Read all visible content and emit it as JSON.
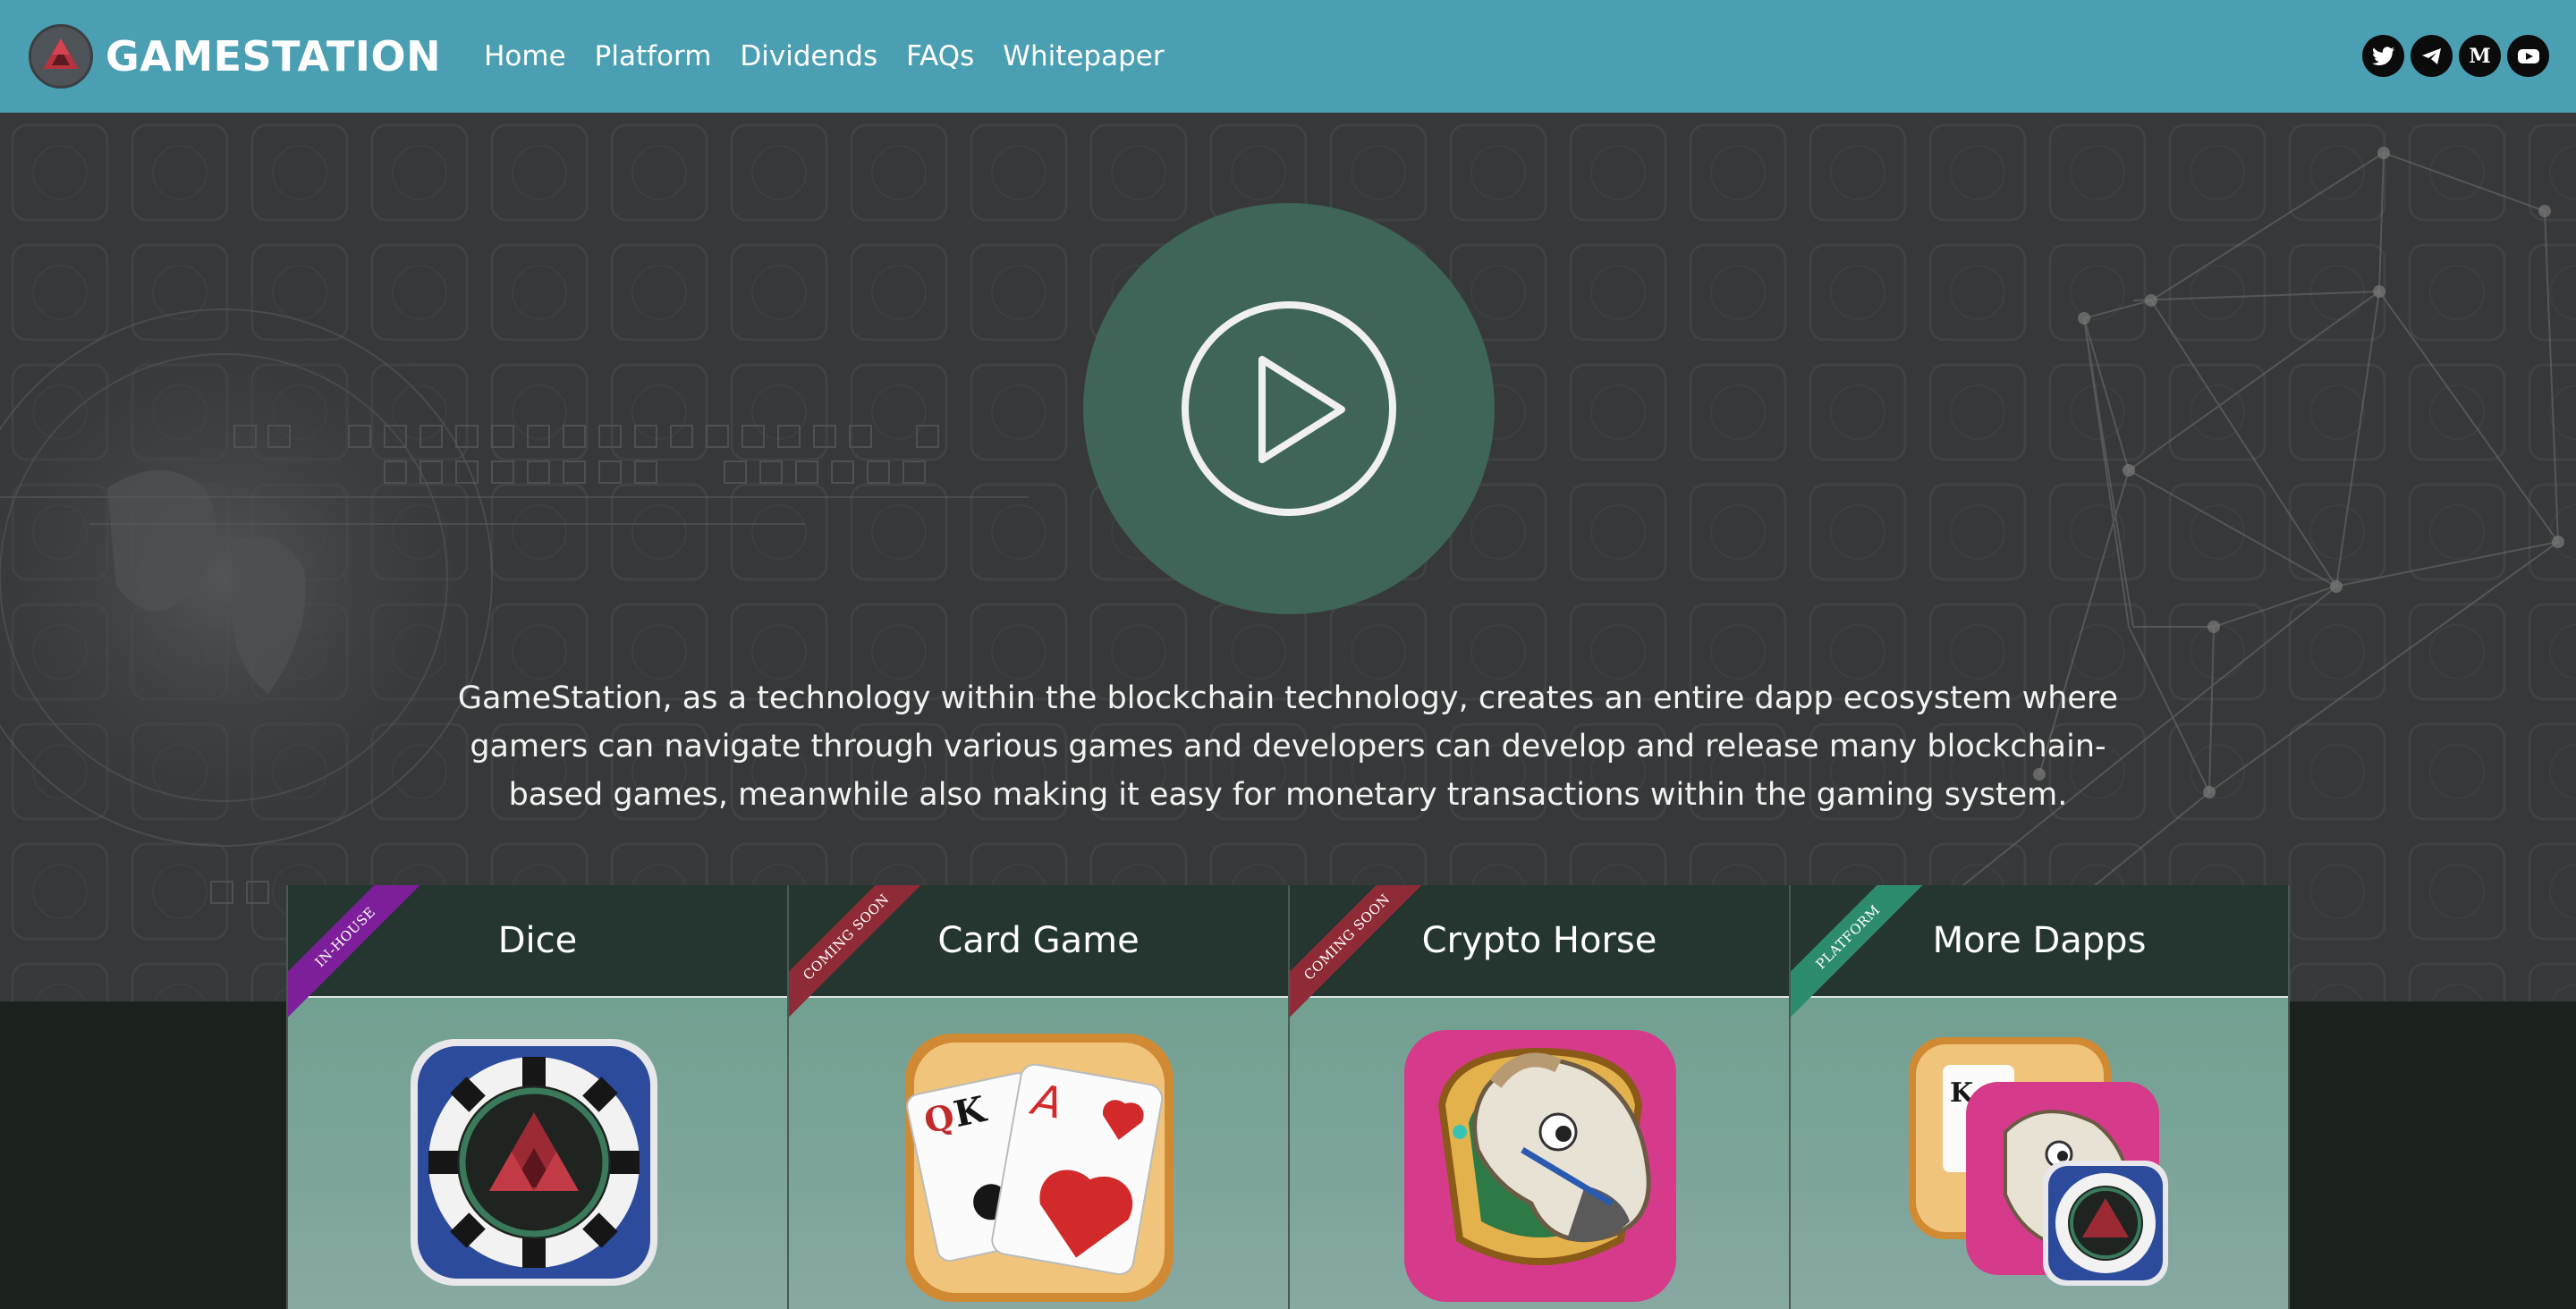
{
  "nav": {
    "brand": "GAMESTATION",
    "links": [
      "Home",
      "Platform",
      "Dividends",
      "FAQs",
      "Whitepaper"
    ],
    "social": [
      "twitter-icon",
      "telegram-icon",
      "medium-icon",
      "youtube-icon"
    ],
    "medium_glyph": "M"
  },
  "hero": {
    "description": "GameStation, as a technology within the blockchain technology, creates an entire dapp ecosystem where gamers can navigate through various games and developers can develop and release many blockchain-based games, meanwhile also making it easy for monetary transactions within the gaming system."
  },
  "cards": [
    {
      "title": "Dice",
      "ribbon": "IN-HOUSE",
      "ribbon_color": "#7d1f9a"
    },
    {
      "title": "Card Game",
      "ribbon": "COMING SOON",
      "ribbon_color": "#8e2b36"
    },
    {
      "title": "Crypto Horse",
      "ribbon": "COMING SOON",
      "ribbon_color": "#8e2b36"
    },
    {
      "title": "More Dapps",
      "ribbon": "PLATFORM",
      "ribbon_color": "#2e8c6e"
    }
  ],
  "colors": {
    "navbar": "#4b9fb3",
    "hero_bg": "#37383a",
    "play_circle": "#3f6458",
    "card_header": "#253631"
  }
}
